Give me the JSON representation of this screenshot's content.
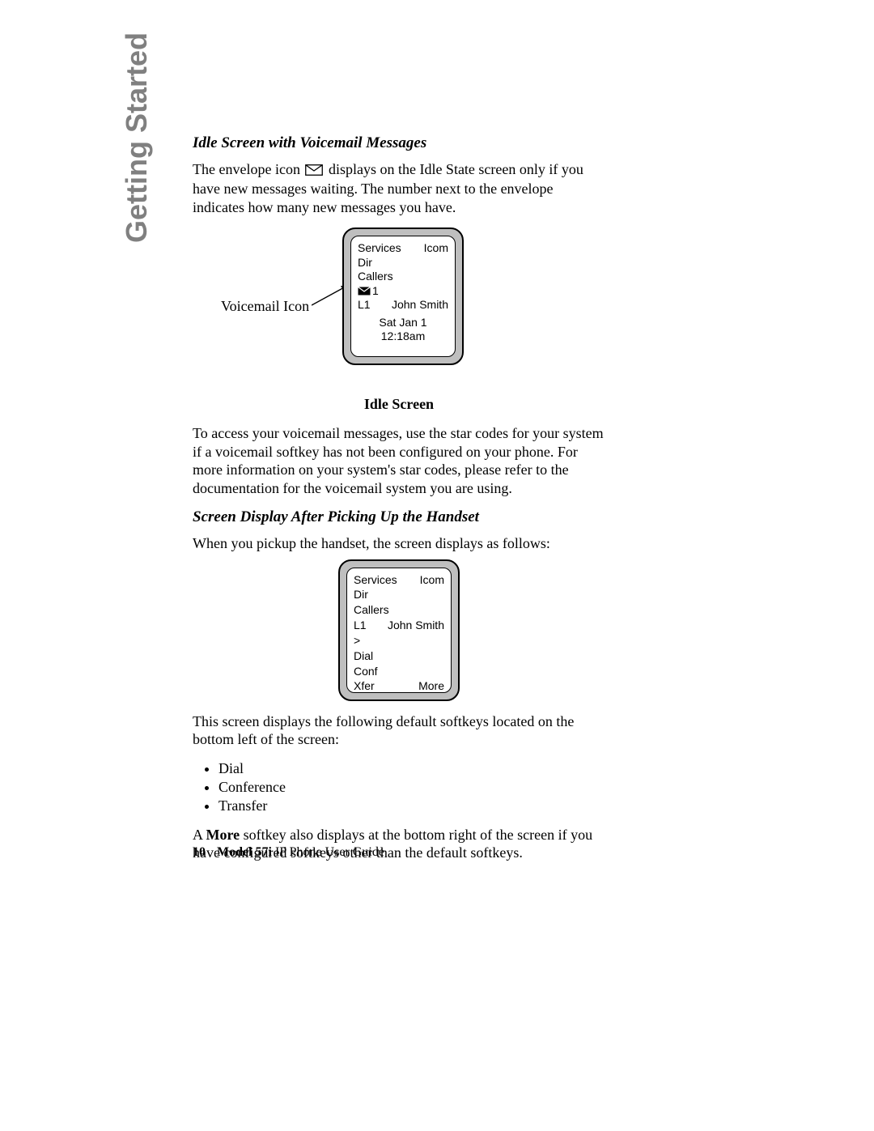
{
  "side_tab": "Getting Started",
  "section1": {
    "heading": "Idle Screen with Voicemail Messages",
    "para_pre": "The envelope icon ",
    "para_post": " displays on the Idle State screen only if you have new messages waiting. The number next to the envelope indicates how many new messages you have."
  },
  "fig1": {
    "callout": "Voicemail Icon",
    "services": "Services",
    "icom": "Icom",
    "dir": "Dir",
    "callers": "Callers",
    "vm_count": "1",
    "line": "L1",
    "user": "John Smith",
    "datetime": "Sat Jan 1  12:18am",
    "caption": "Idle Screen"
  },
  "para_access": "To access your voicemail messages, use the star codes for your system if a voicemail softkey has not been configured on your phone. For more information on your system's star codes, please refer to the documentation for the voicemail system you are using.",
  "section2": {
    "heading": "Screen Display After Picking Up the Handset",
    "para": "When you pickup the handset, the screen displays as follows:"
  },
  "fig2": {
    "services": "Services",
    "icom": "Icom",
    "dir": "Dir",
    "callers": "Callers",
    "line": "L1",
    "user": "John Smith",
    "prompt": ">",
    "dial": "Dial",
    "conf": "Conf",
    "xfer": "Xfer",
    "more": "More"
  },
  "para_softkeys_intro": "This screen displays the following default softkeys located on the bottom left of the screen:",
  "bullets": {
    "b1": "Dial",
    "b2": "Conference",
    "b3": "Transfer"
  },
  "para_more_pre": "A ",
  "para_more_bold": "More",
  "para_more_post": " softkey also displays at the bottom right of the screen if you have configured softkeys other than the default softkeys.",
  "footer": {
    "page": "10",
    "model": "Model 57i",
    "tail": " IP Phone User Guide"
  }
}
